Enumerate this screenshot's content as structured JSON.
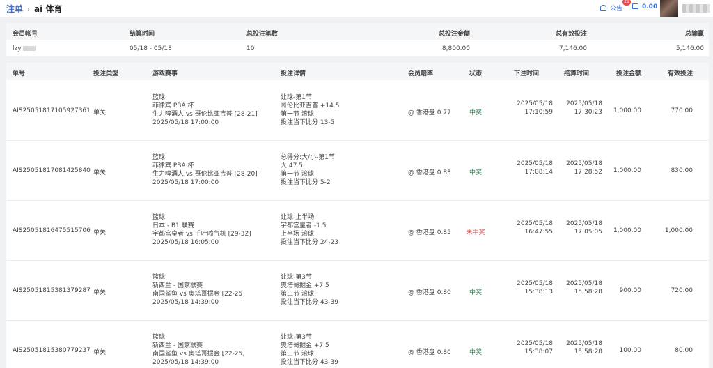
{
  "header": {
    "breadcrumb_root": "注单",
    "breadcrumb_current": "ai 体育",
    "notice_label": "公告",
    "notice_count": "21",
    "balance": "0.00"
  },
  "summary": {
    "columns": [
      "会员帐号",
      "结算时间",
      "总投注笔数",
      "总投注金额",
      "总有效投注",
      "总输赢"
    ],
    "values": {
      "account": "lzy",
      "settle_period": "05/18 - 05/18",
      "bet_count": "10",
      "total_amount": "8,800.00",
      "total_valid": "7,146.00",
      "total_winloss": "5,146.00"
    }
  },
  "table": {
    "columns": [
      "单号",
      "投注类型",
      "游戏赛事",
      "投注详情",
      "会员赔率",
      "状态",
      "下注时间",
      "结算时间",
      "投注金额",
      "有效投注"
    ],
    "rows": [
      {
        "id": "AIS250518171059273 61",
        "type": "单关",
        "event": [
          "篮球",
          "菲律宾 PBA 杯",
          "生力啤酒人 vs 哥伦比亚吉普 [28-21]",
          "2025/05/18 17:00:00"
        ],
        "detail": [
          "让球-第1节",
          "哥伦比亚吉普 +14.5",
          "第一节 滚球",
          "投注当下比分 13-5"
        ],
        "odds": "@ 香港盘 0.77",
        "status": "中奖",
        "status_kind": "win",
        "bet_time": [
          "2025/05/18",
          "17:10:59"
        ],
        "settle_time": [
          "2025/05/18",
          "17:30:23"
        ],
        "amount": "1,000.00",
        "valid": "770.00"
      },
      {
        "id": "AIS25051817081425840",
        "type": "单关",
        "event": [
          "篮球",
          "菲律宾 PBA 杯",
          "生力啤酒人 vs 哥伦比亚吉普 [28-20]",
          "2025/05/18 17:00:00"
        ],
        "detail": [
          "总得分:大/小-第1节",
          "大 47.5",
          "第一节 滚球",
          "投注当下比分 5-2"
        ],
        "odds": "@ 香港盘 0.83",
        "status": "中奖",
        "status_kind": "win",
        "bet_time": [
          "2025/05/18",
          "17:08:14"
        ],
        "settle_time": [
          "2025/05/18",
          "17:28:52"
        ],
        "amount": "1,000.00",
        "valid": "830.00"
      },
      {
        "id": "AIS25051816475515706",
        "type": "单关",
        "event": [
          "篮球",
          "日本 - B1 联赛",
          "宇都宫皇者 vs 千叶喷气机 [29-32]",
          "2025/05/18 16:05:00"
        ],
        "detail": [
          "让球-上半场",
          "宇都宫皇者 -1.5",
          "上半场 滚球",
          "投注当下比分 24-23"
        ],
        "odds": "@ 香港盘 0.85",
        "status": "未中奖",
        "status_kind": "lose",
        "bet_time": [
          "2025/05/18",
          "16:47:55"
        ],
        "settle_time": [
          "2025/05/18",
          "17:05:05"
        ],
        "amount": "1,000.00",
        "valid": "1,000.00"
      },
      {
        "id": "AIS25051815381379287",
        "type": "单关",
        "event": [
          "篮球",
          "新西兰 - 国家联赛",
          "南国鲨鱼 vs 奥塔哥掘金 [22-25]",
          "2025/05/18 14:39:00"
        ],
        "detail": [
          "让球-第3节",
          "奥塔哥掘金 +7.5",
          "第三节 滚球",
          "投注当下比分 43-39"
        ],
        "odds": "@ 香港盘 0.80",
        "status": "中奖",
        "status_kind": "win",
        "bet_time": [
          "2025/05/18",
          "15:38:13"
        ],
        "settle_time": [
          "2025/05/18",
          "15:58:28"
        ],
        "amount": "900.00",
        "valid": "720.00"
      },
      {
        "id": "AIS25051815380779237",
        "type": "单关",
        "event": [
          "篮球",
          "新西兰 - 国家联赛",
          "南国鲨鱼 vs 奥塔哥掘金 [22-25]",
          "2025/05/18 14:39:00"
        ],
        "detail": [
          "让球-第3节",
          "奥塔哥掘金 +7.5",
          "第三节 滚球",
          "投注当下比分 43-39"
        ],
        "odds": "@ 香港盘 0.80",
        "status": "中奖",
        "status_kind": "win",
        "bet_time": [
          "2025/05/18",
          "15:38:07"
        ],
        "settle_time": [
          "2025/05/18",
          "15:58:28"
        ],
        "amount": "100.00",
        "valid": "80.00"
      }
    ]
  }
}
